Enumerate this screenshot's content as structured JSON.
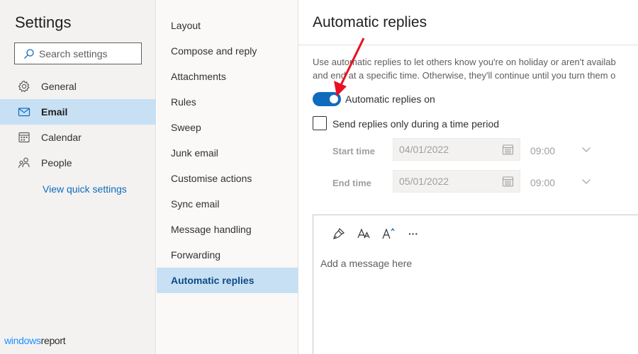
{
  "sidebar": {
    "title": "Settings",
    "search_placeholder": "Search settings",
    "items": [
      {
        "label": "General",
        "icon": "gear-icon"
      },
      {
        "label": "Email",
        "icon": "mail-icon",
        "active": true
      },
      {
        "label": "Calendar",
        "icon": "calendar-icon"
      },
      {
        "label": "People",
        "icon": "people-icon"
      }
    ],
    "quick_settings_label": "View quick settings"
  },
  "submenu": {
    "items": [
      {
        "label": "Layout"
      },
      {
        "label": "Compose and reply"
      },
      {
        "label": "Attachments"
      },
      {
        "label": "Rules"
      },
      {
        "label": "Sweep"
      },
      {
        "label": "Junk email"
      },
      {
        "label": "Customise actions"
      },
      {
        "label": "Sync email"
      },
      {
        "label": "Message handling"
      },
      {
        "label": "Forwarding"
      },
      {
        "label": "Automatic replies",
        "active": true
      }
    ]
  },
  "content": {
    "title": "Automatic replies",
    "description_line1": "Use automatic replies to let others know you're on holiday or aren't availab",
    "description_line2": "and end at a specific time. Otherwise, they'll continue until you turn them o",
    "toggle_label": "Automatic replies on",
    "toggle_on": true,
    "time_period_label": "Send replies only during a time period",
    "time_period_checked": false,
    "start_time_label": "Start time",
    "start_date": "04/01/2022",
    "start_time": "09:00",
    "end_time_label": "End time",
    "end_date": "05/01/2022",
    "end_time": "09:00",
    "editor": {
      "tools": [
        "format-painter-icon",
        "font-size-icon",
        "text-highlight-icon",
        "more-options-icon"
      ],
      "more_label": "···",
      "message_placeholder": "Add a message here"
    }
  },
  "branding": {
    "prefix": "windows",
    "suffix": "report"
  },
  "colors": {
    "accent": "#0f6cbd",
    "selected_bg": "#c7e0f4",
    "annotation_arrow": "#e81123"
  }
}
